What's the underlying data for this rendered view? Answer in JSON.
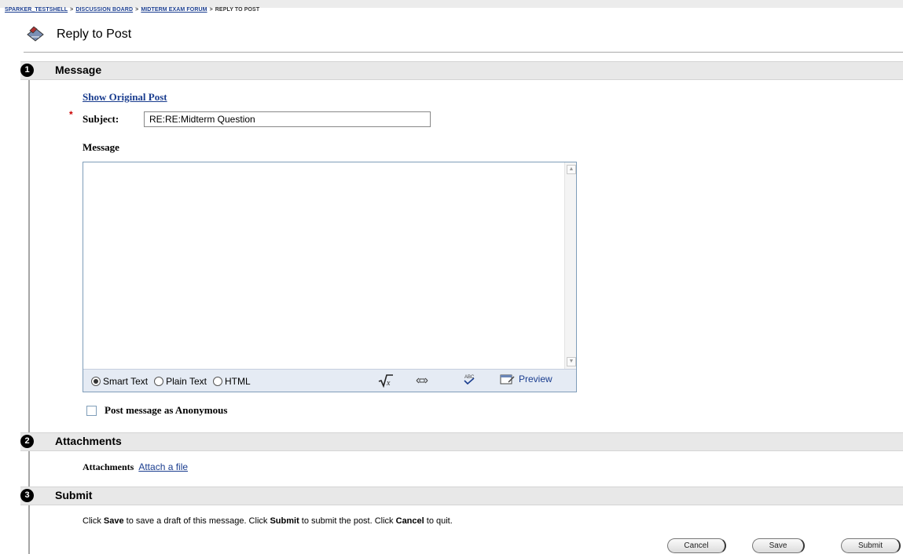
{
  "breadcrumb": {
    "items": [
      "SPARKER_TESTSHELL",
      "DISCUSSION BOARD",
      "MIDTERM EXAM FORUM"
    ],
    "current": "REPLY TO POST",
    "separator": ">"
  },
  "page": {
    "title": "Reply to Post"
  },
  "steps": {
    "message": {
      "number": "1",
      "title": "Message"
    },
    "attachments": {
      "number": "2",
      "title": "Attachments"
    },
    "submit": {
      "number": "3",
      "title": "Submit"
    }
  },
  "message_section": {
    "show_original_link": "Show Original Post",
    "required_mark": "*",
    "subject_label": "Subject:",
    "subject_value": "RE:RE:Midterm Question",
    "message_label": "Message",
    "message_value": "",
    "text_modes": [
      "Smart Text",
      "Plain Text",
      "HTML"
    ],
    "selected_mode": "Smart Text",
    "toolbar_icons": [
      "math-equation-icon",
      "link-icon",
      "spellcheck-icon",
      "preview-icon"
    ],
    "preview_label": "Preview",
    "anonymous_label": "Post message as Anonymous",
    "anonymous_checked": false
  },
  "attachments_section": {
    "label": "Attachments",
    "link": "Attach a file"
  },
  "submit_section": {
    "note": {
      "p1": "Click ",
      "save": "Save",
      "p2": " to save a draft of this message. Click ",
      "submit": "Submit",
      "p3": " to submit the post. Click ",
      "cancel": "Cancel",
      "p4": " to quit."
    },
    "buttons": {
      "cancel": "Cancel",
      "save": "Save",
      "submit": "Submit"
    }
  },
  "colors": {
    "link": "#1a3d8f",
    "step_bar": "#e8e8e8",
    "required": "#cc0000",
    "editor_toolbar": "#e5ebf4"
  }
}
